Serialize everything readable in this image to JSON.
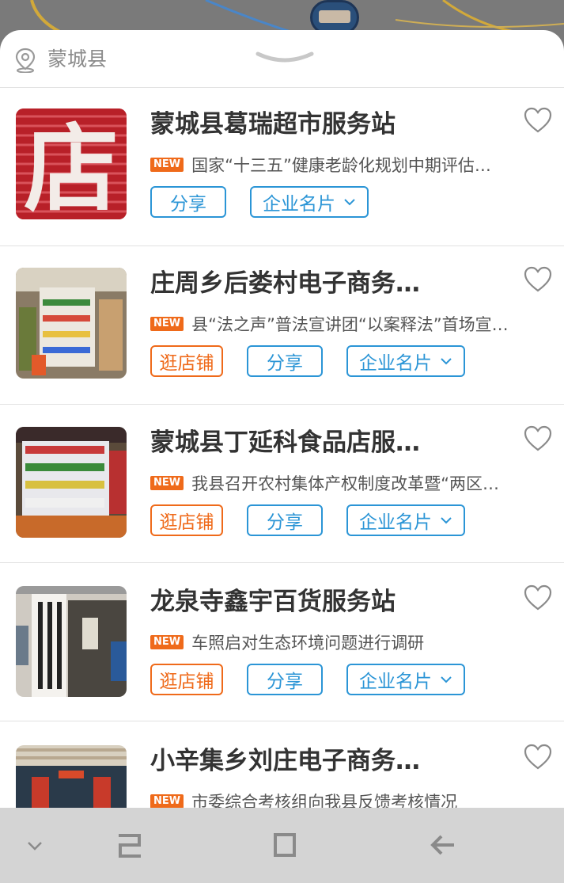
{
  "location": {
    "label": "蒙城县",
    "icon": "location-pin-icon"
  },
  "stores": [
    {
      "title": "蒙城县葛瑞超市服务站",
      "news": "国家“十三五”健康老龄化规划中期评估…",
      "badge": "NEW",
      "has_visit": false,
      "visit_label": "",
      "share_label": "分享",
      "card_label": "企业名片",
      "thumb": "store-sign"
    },
    {
      "title": "庄周乡后娄村电子商务…",
      "news": "县“法之声”普法宣讲团“以案释法”首场宣…",
      "badge": "NEW",
      "has_visit": true,
      "visit_label": "逛店铺",
      "share_label": "分享",
      "card_label": "企业名片",
      "thumb": "shelves"
    },
    {
      "title": "蒙城县丁延科食品店服…",
      "news": "我县召开农村集体产权制度改革暨“两区…",
      "badge": "NEW",
      "has_visit": true,
      "visit_label": "逛店铺",
      "share_label": "分享",
      "card_label": "企业名片",
      "thumb": "shelves2"
    },
    {
      "title": "龙泉寺鑫宇百货服务站",
      "news": "车照启对生态环境问题进行调研",
      "badge": "NEW",
      "has_visit": true,
      "visit_label": "逛店铺",
      "share_label": "分享",
      "card_label": "企业名片",
      "thumb": "storefront"
    },
    {
      "title": "小辛集乡刘庄电子商务…",
      "news": "市委综合考核组向我县反馈考核情况",
      "badge": "NEW",
      "has_visit": false,
      "visit_label": "",
      "share_label": "",
      "card_label": "",
      "thumb": "shopfront"
    }
  ],
  "colors": {
    "accent_blue": "#2b95d6",
    "accent_orange": "#ef6a1a",
    "title": "#333333"
  },
  "navbar": {
    "icons": [
      "chevron-down-icon",
      "recent-apps-icon",
      "home-icon",
      "back-icon"
    ]
  }
}
